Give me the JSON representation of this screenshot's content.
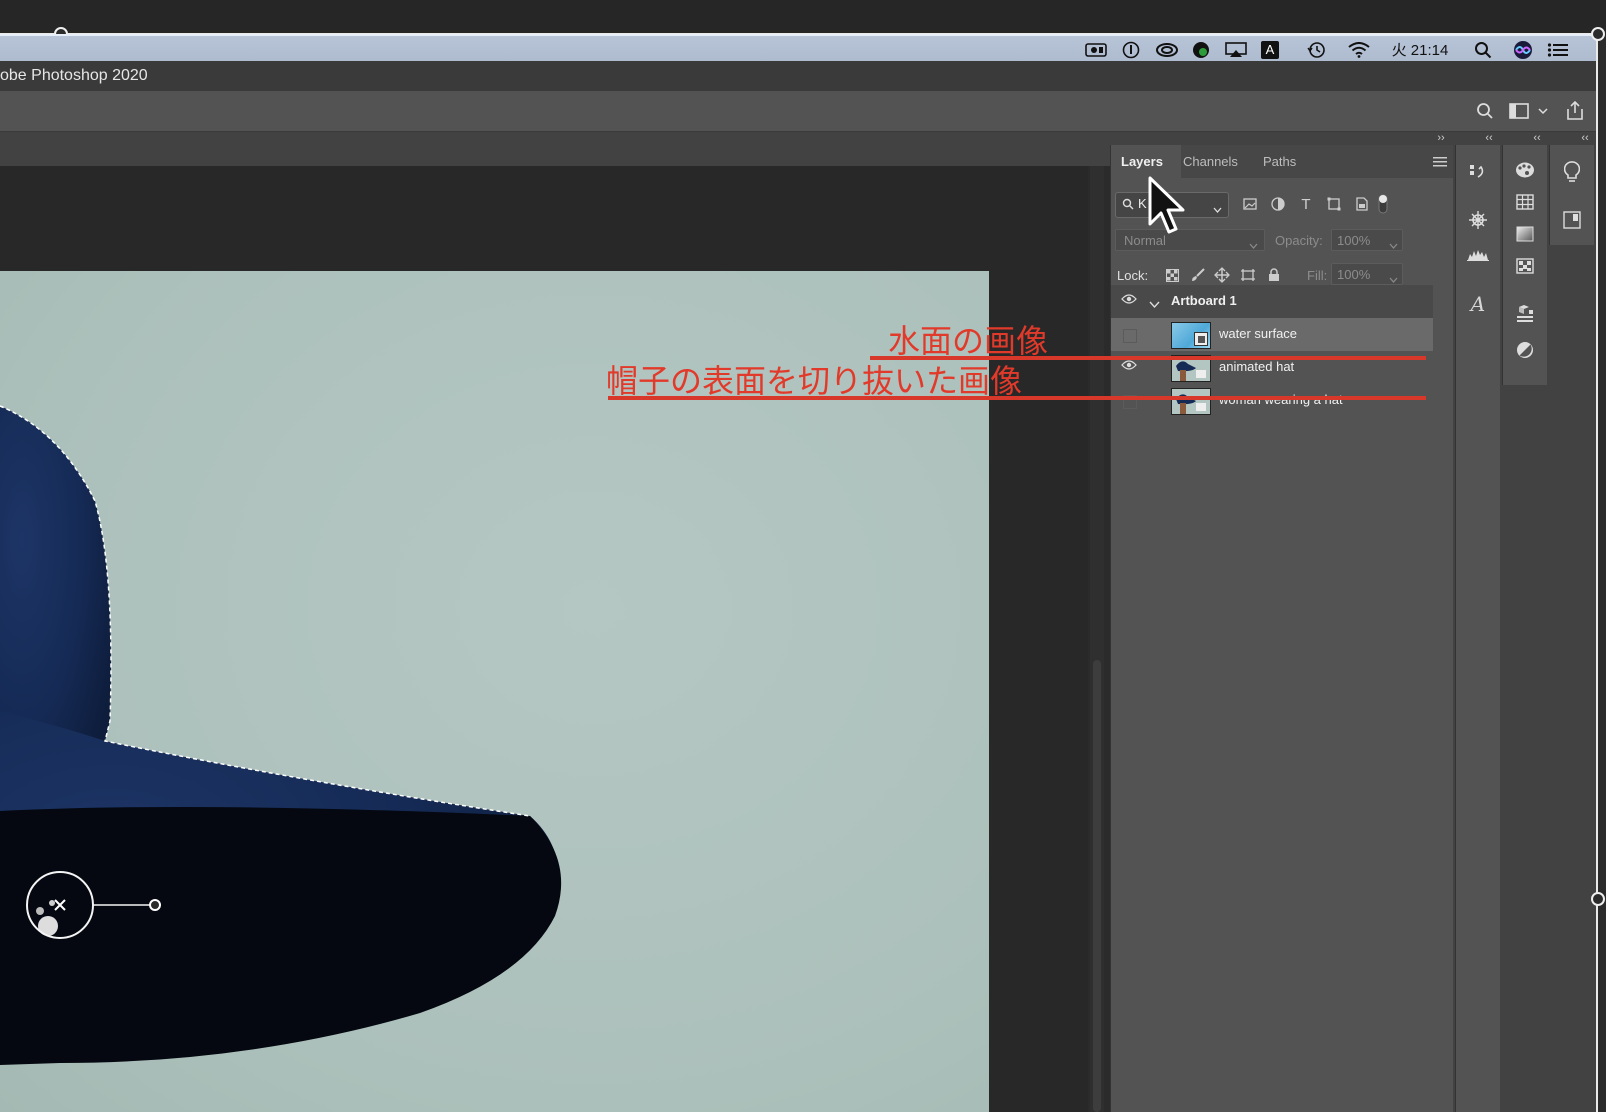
{
  "menubar": {
    "clock": "火 21:14",
    "icons": [
      "screen-record-icon",
      "info-icon",
      "creative-cloud-icon",
      "messenger-icon",
      "airplay-icon",
      "input-method-icon",
      "time-machine-icon",
      "wifi-icon",
      "spotlight-icon",
      "siri-icon",
      "control-center-icon"
    ],
    "input_method_glyph": "A"
  },
  "window": {
    "title": "obe Photoshop 2020"
  },
  "layers_panel": {
    "tabs": [
      "Layers",
      "Channels",
      "Paths"
    ],
    "filter_value": "K",
    "blend_mode": "Normal",
    "opacity_label": "Opacity:",
    "opacity_value": "100%",
    "lock_label": "Lock:",
    "fill_label": "Fill:",
    "fill_value": "100%",
    "artboard": "Artboard 1",
    "layers": [
      {
        "name": "water surface",
        "visible": false,
        "selected": true
      },
      {
        "name": "animated hat",
        "visible": true,
        "selected": false
      },
      {
        "name": "woman wearing a hat",
        "visible": false,
        "selected": false
      }
    ]
  },
  "annotations": {
    "water": "水面の画像",
    "hat": "帽子の表面を切り抜いた画像",
    "color": "#e23a2a"
  }
}
